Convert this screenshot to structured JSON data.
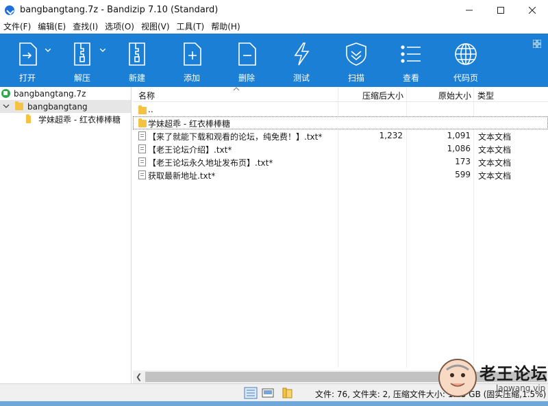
{
  "window": {
    "title": "bangbangtang.7z - Bandizip 7.10 (Standard)"
  },
  "menu": [
    "文件(F)",
    "编辑(E)",
    "查找(I)",
    "选项(O)",
    "视图(V)",
    "工具(T)",
    "帮助(H)"
  ],
  "toolbar": {
    "items": [
      {
        "label": "打开",
        "icon": "open-icon",
        "dropdown": true
      },
      {
        "label": "解压",
        "icon": "extract-icon",
        "dropdown": true
      },
      {
        "label": "新建",
        "icon": "new-archive-icon"
      },
      {
        "label": "添加",
        "icon": "add-icon"
      },
      {
        "label": "删除",
        "icon": "delete-icon"
      },
      {
        "label": "测试",
        "icon": "test-icon"
      },
      {
        "label": "扫描",
        "icon": "scan-icon"
      },
      {
        "label": "查看",
        "icon": "view-icon"
      },
      {
        "label": "代码页",
        "icon": "codepage-icon"
      }
    ]
  },
  "tree": {
    "root": "bangbangtang.7z",
    "folder": "bangbangtang",
    "subfolder": "学妹超乖 - 红衣棒棒糖"
  },
  "list": {
    "headers": {
      "name": "名称",
      "packed": "压缩后大小",
      "original": "原始大小",
      "type": "类型"
    },
    "rows": [
      {
        "kind": "folder",
        "name": "..",
        "packed": "",
        "original": "",
        "type": ""
      },
      {
        "kind": "folder",
        "name": "学妹超乖 - 红衣棒棒糖",
        "packed": "",
        "original": "",
        "type": ""
      },
      {
        "kind": "file",
        "name": "【来了就能下载和观看的论坛，纯免费！】.txt*",
        "packed": "1,232",
        "original": "1,091",
        "type": "文本文档"
      },
      {
        "kind": "file",
        "name": "【老王论坛介绍】.txt*",
        "packed": "",
        "original": "1,086",
        "type": "文本文档"
      },
      {
        "kind": "file",
        "name": "【老王论坛永久地址发布页】.txt*",
        "packed": "",
        "original": "173",
        "type": "文本文档"
      },
      {
        "kind": "file",
        "name": "获取最新地址.txt*",
        "packed": "",
        "original": "599",
        "type": "文本文档"
      }
    ]
  },
  "status": {
    "text": "文件: 76, 文件夹: 2, 压缩文件大小: 1.15 GB (固实压缩,1.5%)"
  },
  "watermark": {
    "title": "老王论坛",
    "url": "laowang.vip"
  },
  "colors": {
    "toolbar": "#1c7fd6",
    "folder": "#f5c343",
    "selection": "#e6e6e6"
  }
}
